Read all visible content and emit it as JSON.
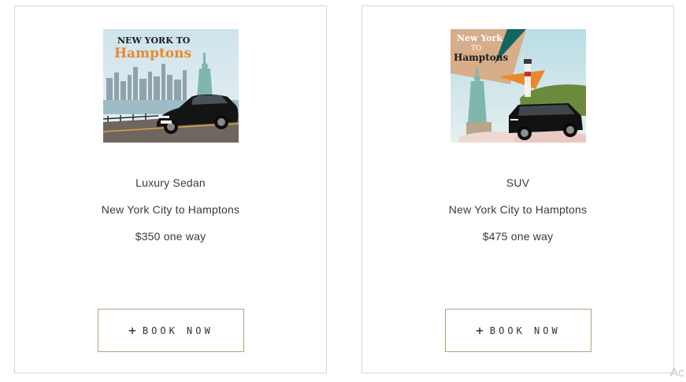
{
  "cards": [
    {
      "title": "Luxury Sedan",
      "route": "New York City to Hamptons",
      "price": "$350 one way",
      "image": {
        "line1": "NEW YORK TO",
        "line2": "Hamptons"
      },
      "button_icon": "+",
      "button_label": "BOOK NOW"
    },
    {
      "title": "SUV",
      "route": "New York City to Hamptons",
      "price": "$475 one way",
      "image": {
        "line1": "New York",
        "line2": "TO",
        "line3": "Hamptons"
      },
      "button_icon": "+",
      "button_label": "BOOK NOW"
    }
  ],
  "corner_text": "Ac",
  "colors": {
    "card_border": "#d6d6d6",
    "button_border": "#b59f80",
    "text": "#3a3a3a",
    "accent_orange": "#e8892b"
  }
}
